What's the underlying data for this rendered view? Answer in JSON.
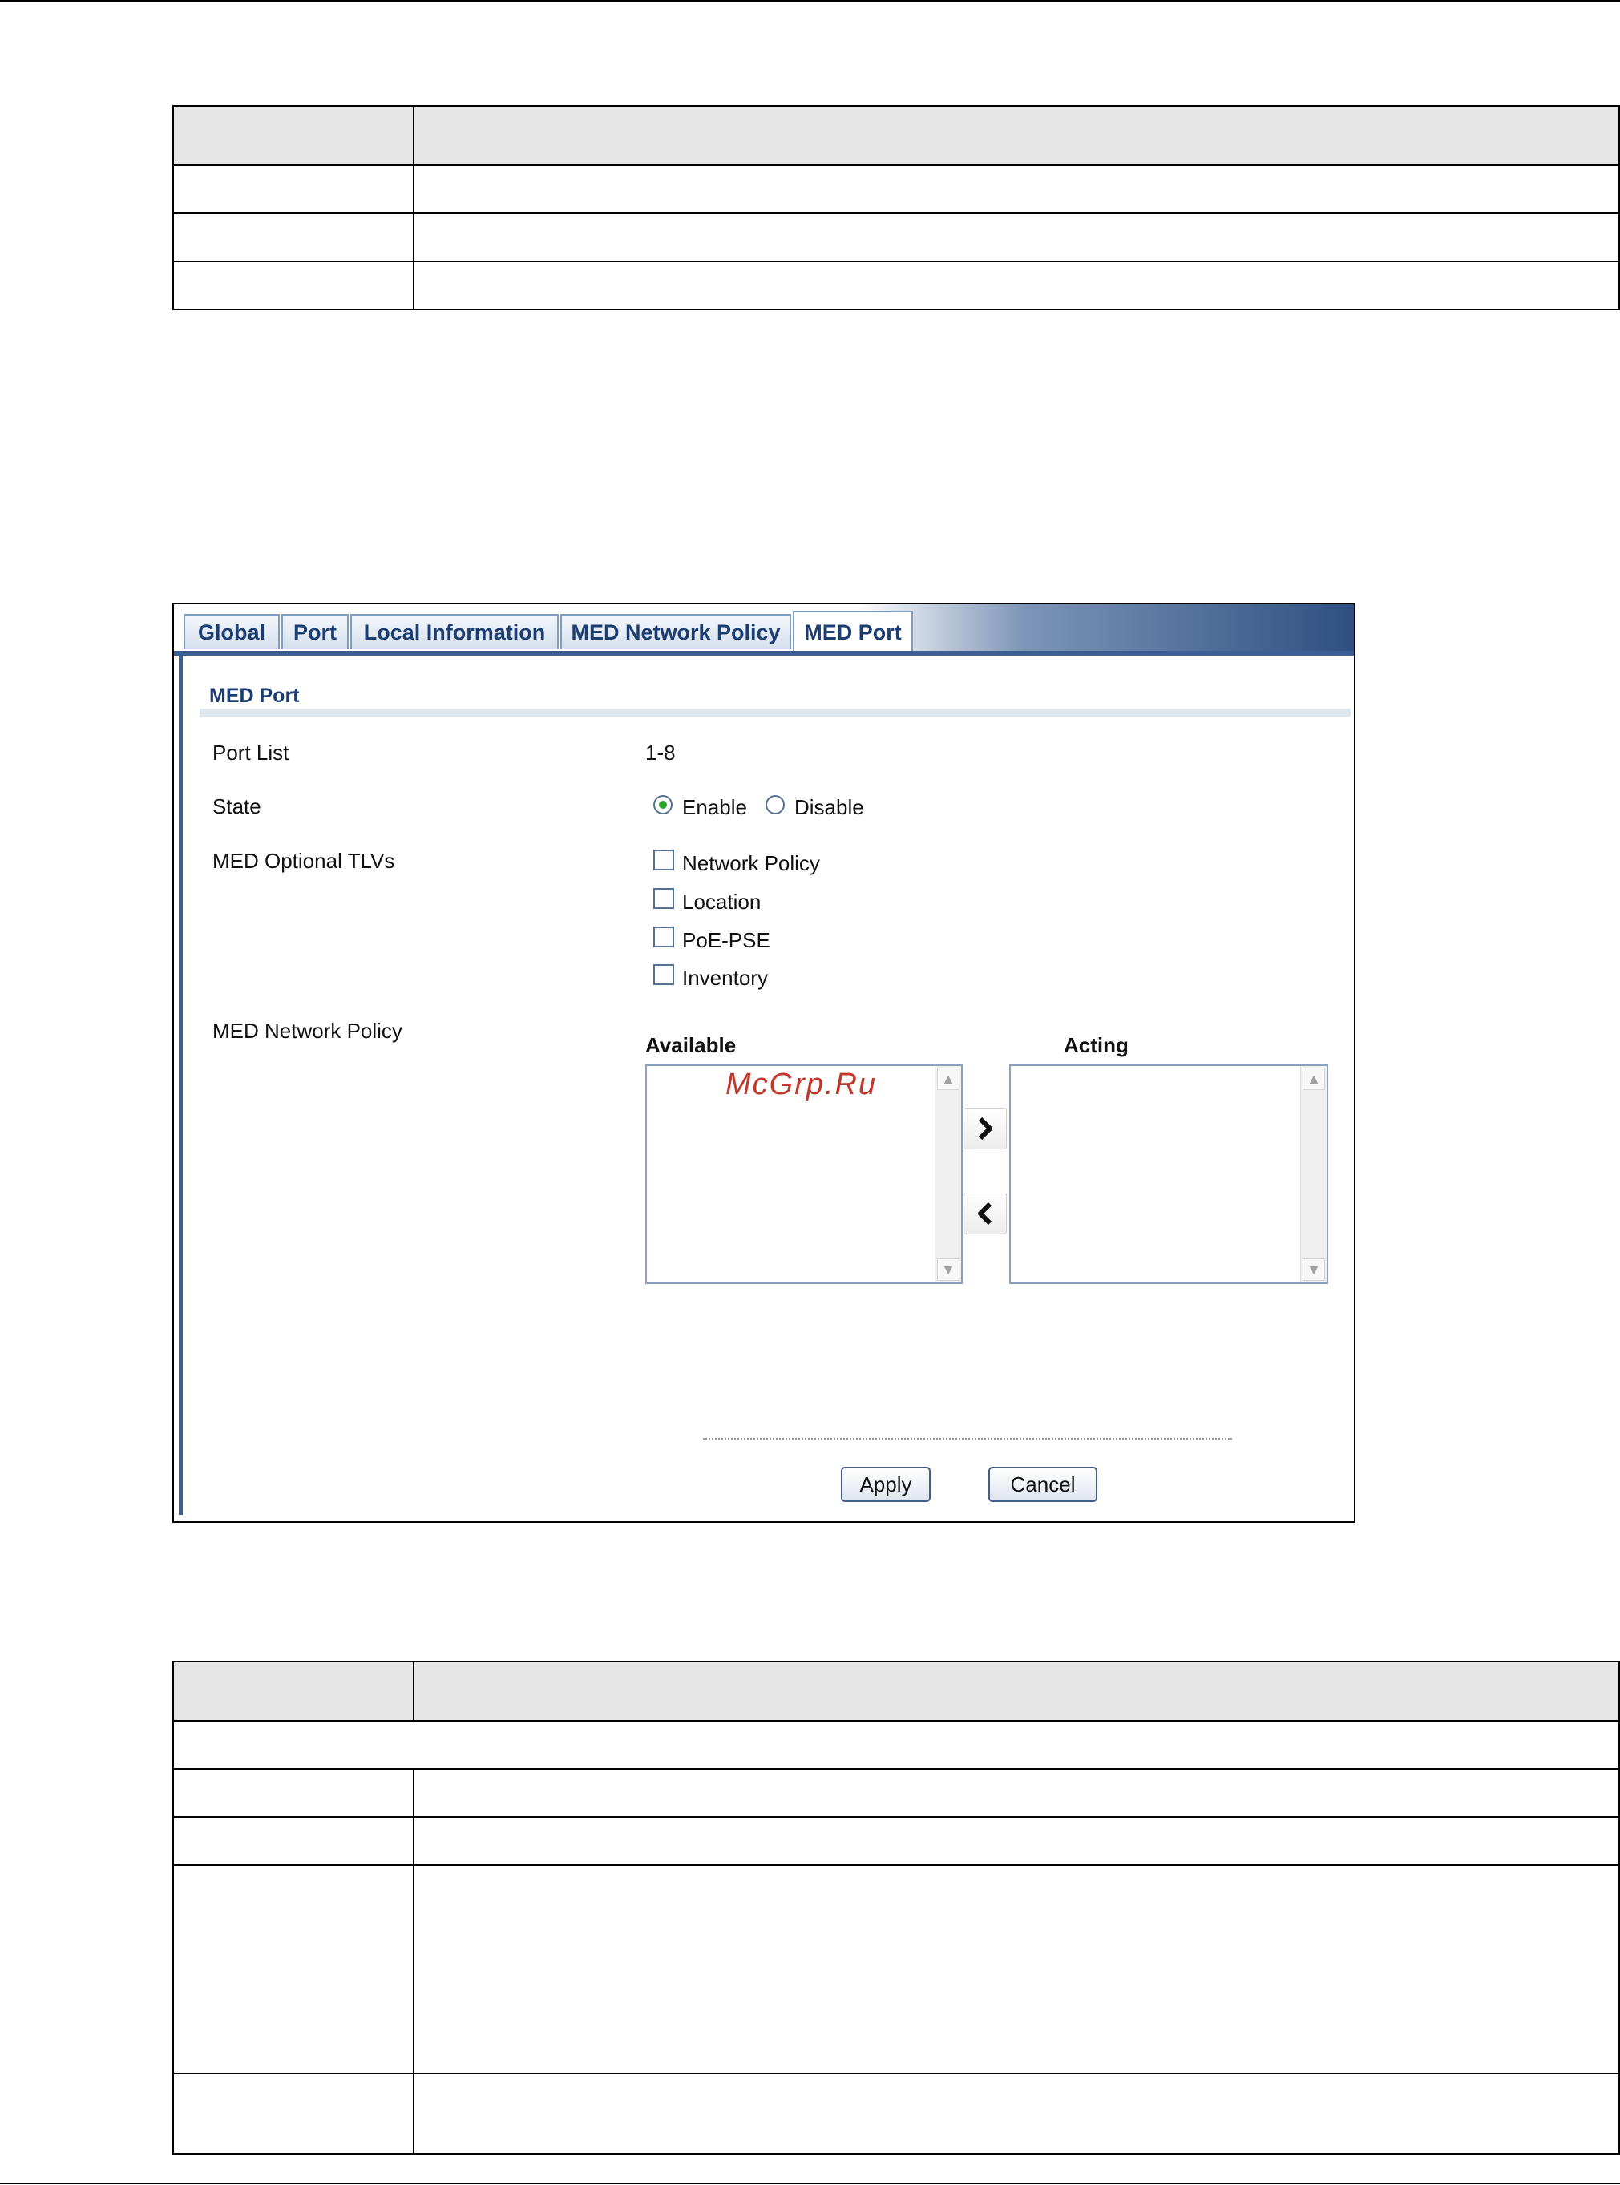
{
  "panel": {
    "tabs": [
      {
        "label": "Global"
      },
      {
        "label": "Port"
      },
      {
        "label": "Local Information"
      },
      {
        "label": "MED Network Policy"
      },
      {
        "label": "MED Port"
      }
    ],
    "section_title": "MED Port",
    "fields": {
      "port_list_label": "Port List",
      "port_list_value": "1-8",
      "state_label": "State",
      "state_enable": "Enable",
      "state_disable": "Disable",
      "state_selected": "Enable",
      "tlv_label": "MED Optional TLVs",
      "tlv_options": [
        "Network Policy",
        "Location",
        "PoE-PSE",
        "Inventory"
      ],
      "network_policy_label": "MED Network Policy",
      "available_label": "Available",
      "acting_label": "Acting"
    },
    "buttons": {
      "apply": "Apply",
      "cancel": "Cancel"
    },
    "watermark": "McGrp.Ru"
  }
}
